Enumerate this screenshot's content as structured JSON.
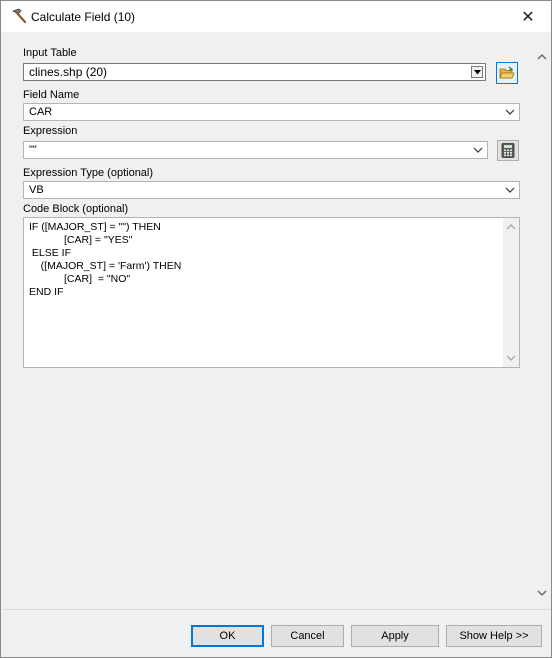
{
  "window": {
    "title": "Calculate Field (10)",
    "close_symbol": "✕"
  },
  "form": {
    "input_table": {
      "label": "Input Table",
      "value": "clines.shp (20)"
    },
    "field_name": {
      "label": "Field Name",
      "value": "CAR"
    },
    "expression": {
      "label": "Expression",
      "value": "\"\""
    },
    "expression_type": {
      "label": "Expression Type (optional)",
      "value": "VB"
    },
    "code_block": {
      "label": "Code Block (optional)",
      "lines": [
        "IF ([MAJOR_ST] = \"\") THEN",
        "            [CAR] = \"YES\"",
        " ELSE IF",
        "    ([MAJOR_ST] = 'Farm') THEN",
        "            [CAR]  = \"NO\"",
        "END IF"
      ]
    }
  },
  "buttons": {
    "ok": "OK",
    "cancel": "Cancel",
    "apply": "Apply",
    "show_help": "Show Help >>"
  },
  "icons": {
    "title": "hammer-icon",
    "browse": "open-folder-icon",
    "calculator": "calculator-icon"
  }
}
